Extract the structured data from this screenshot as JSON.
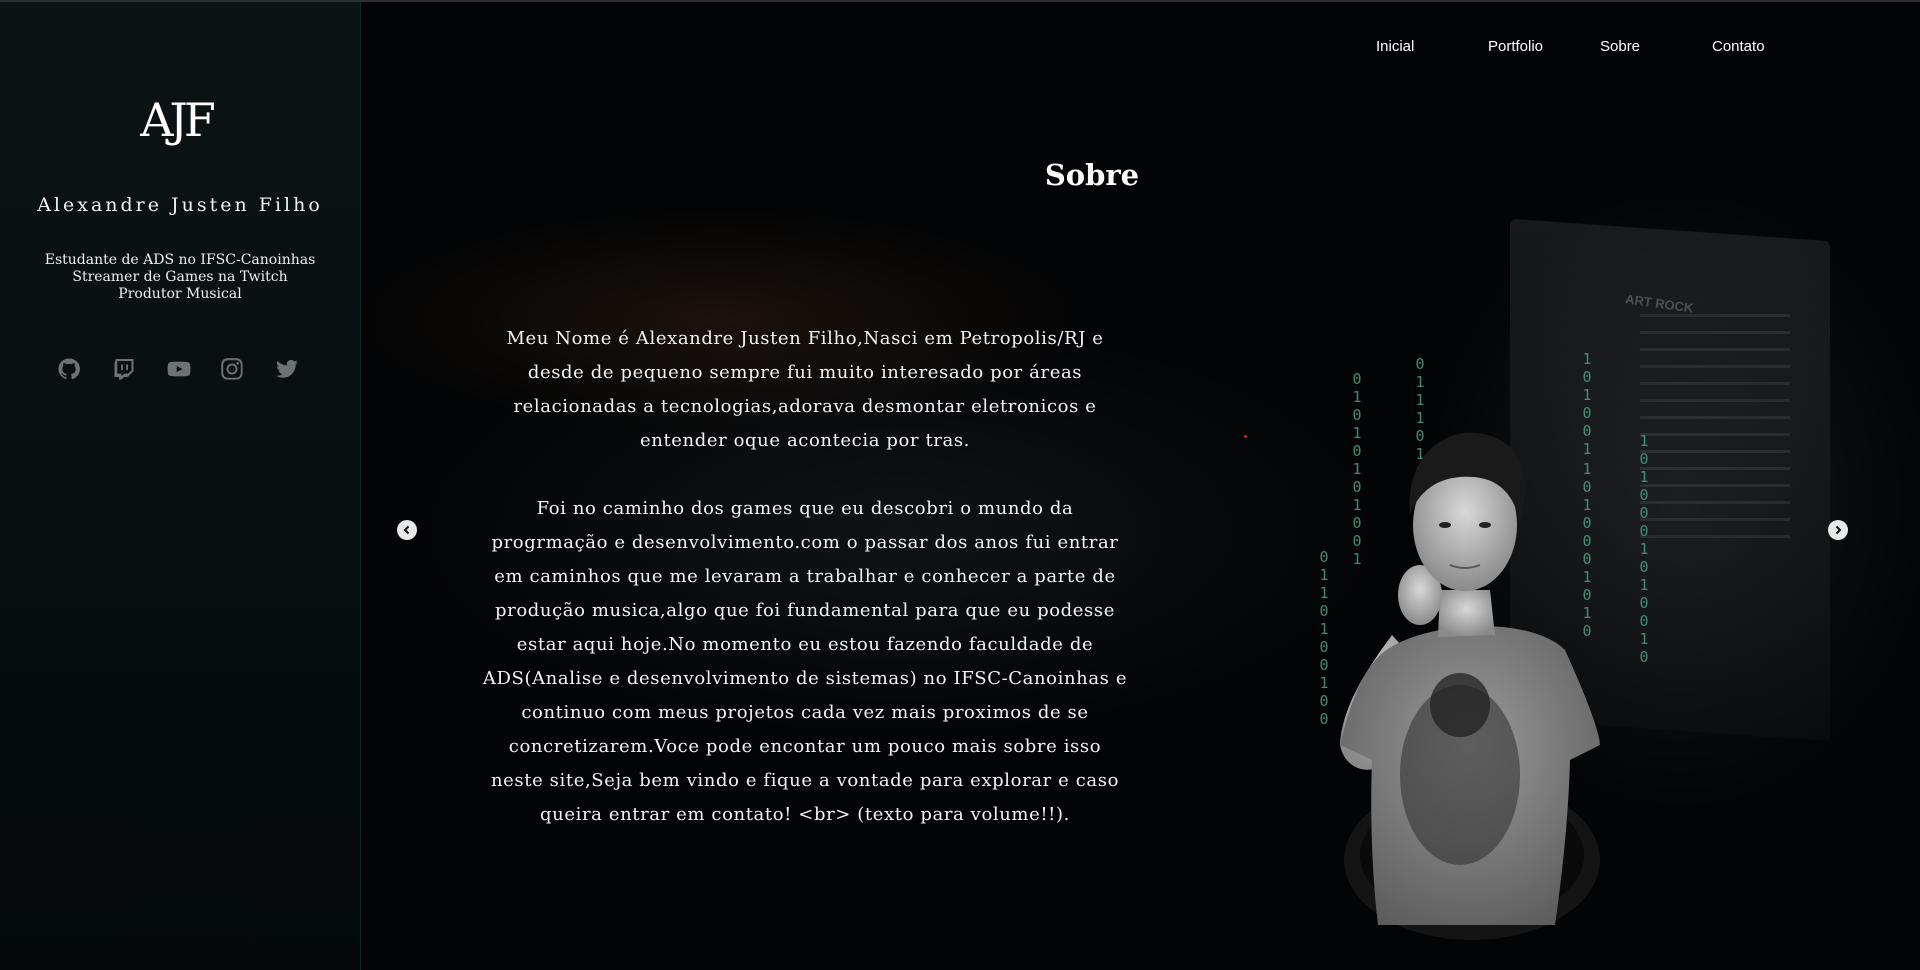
{
  "sidebar": {
    "logo_text": "AJF",
    "name": "Alexandre Justen Filho",
    "bio_lines": [
      "Estudante de ADS no IFSC-Canoinhas",
      "Streamer de Games na Twitch",
      "Produtor Musical"
    ],
    "socials": [
      {
        "name": "github-icon"
      },
      {
        "name": "twitch-icon"
      },
      {
        "name": "youtube-icon"
      },
      {
        "name": "instagram-icon"
      },
      {
        "name": "twitter-icon"
      }
    ]
  },
  "nav": {
    "items": [
      "Inicial",
      "Portfolio",
      "Sobre",
      "Contato"
    ]
  },
  "main": {
    "title": "Sobre",
    "paragraphs": [
      "Meu Nome é Alexandre Justen Filho,Nasci em Petropolis/RJ e desde de pequeno sempre fui muito interesado por áreas relacionadas a tecnologias,adorava desmontar eletronicos e entender oque acontecia por tras.",
      "Foi no caminho dos games que eu descobri o mundo da progrmação e desenvolvimento.com o passar dos anos fui entrar em caminhos que me levaram a trabalhar e conhecer a parte de produção musica,algo que foi fundamental para que eu podesse estar aqui hoje.No momento eu estou fazendo faculdade de ADS(Analise e desenvolvimento de sistemas) no IFSC-Canoinhas e continuo com meus projetos cada vez mais proximos de se concretizarem.Voce pode encontar um pouco mais sobre isso neste site,Seja bem vindo e fique a vontade para explorar e caso queira entrar em contato! <br> (texto para volume!!)."
    ],
    "background_label": "ART ROCK"
  },
  "binary_columns": [
    "01010101001",
    "0111010",
    "0110100100",
    "101001",
    "1010001010",
    "1010001010010",
    "0110100100"
  ],
  "colors": {
    "background": "#030405",
    "sidebar": "#081012",
    "binary": "#4aa38a",
    "icon": "#6d7374"
  }
}
